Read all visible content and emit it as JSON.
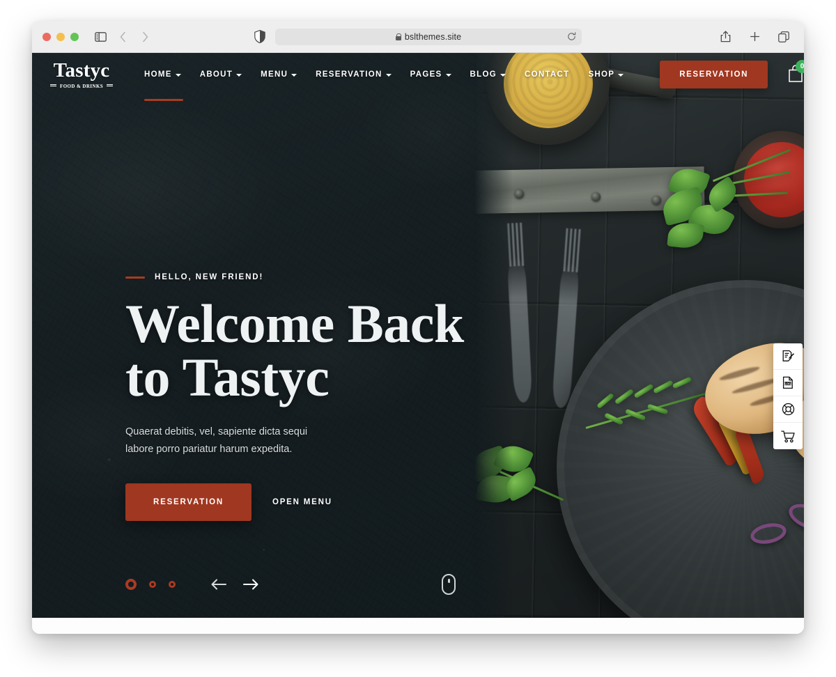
{
  "browser": {
    "app": "Safari",
    "url": "bslthemes.site",
    "traffic_lights": [
      "close",
      "minimize",
      "zoom"
    ],
    "left_icons": [
      "sidebar-icon",
      "back-icon",
      "forward-icon"
    ],
    "address_icons": [
      "shield-icon",
      "lock-icon",
      "reload-icon"
    ],
    "right_icons": [
      "share-icon",
      "new-tab-icon",
      "tab-overview-icon"
    ]
  },
  "site": {
    "logo": {
      "word": "Tastyc",
      "tagline": "FOOD & DRINKS"
    },
    "nav": [
      {
        "label": "HOME",
        "has_dropdown": true,
        "active": true
      },
      {
        "label": "ABOUT",
        "has_dropdown": true,
        "active": false
      },
      {
        "label": "MENU",
        "has_dropdown": true,
        "active": false
      },
      {
        "label": "RESERVATION",
        "has_dropdown": true,
        "active": false
      },
      {
        "label": "PAGES",
        "has_dropdown": true,
        "active": false
      },
      {
        "label": "BLOG",
        "has_dropdown": true,
        "active": false
      },
      {
        "label": "CONTACT",
        "has_dropdown": false,
        "active": false
      },
      {
        "label": "SHOP",
        "has_dropdown": true,
        "active": false
      }
    ],
    "nav_cta": "RESERVATION",
    "cart": {
      "icon": "shopping-bag-icon",
      "count": "0",
      "badge_color": "#3cb45c"
    }
  },
  "hero": {
    "eyebrow": "HELLO, NEW FRIEND!",
    "title_line1": "Welcome Back",
    "title_line2": "to Tastyc",
    "subtitle": "Quaerat debitis, vel, sapiente dicta sequi labore porro pariatur harum expedita.",
    "primary_button": "RESERVATION",
    "secondary_button": "OPEN MENU",
    "slides": [
      "slide-1",
      "slide-2",
      "slide-3"
    ],
    "active_slide": 1,
    "prev_label": "prev-arrow-icon",
    "next_label": "next-arrow-icon",
    "scroll_hint": "scroll-mouse-icon"
  },
  "dock": [
    {
      "icon": "document-edit-icon",
      "name": "notes"
    },
    {
      "icon": "log-file-icon",
      "name": "changelog"
    },
    {
      "icon": "lifebuoy-support-icon",
      "name": "support"
    },
    {
      "icon": "shopping-cart-icon",
      "name": "cart"
    }
  ],
  "colors": {
    "accent": "#A03720",
    "accent_light": "#A93B22",
    "hero_bg": "#151d20",
    "badge_green": "#3cb45c",
    "title_text": "#eef2f3"
  }
}
